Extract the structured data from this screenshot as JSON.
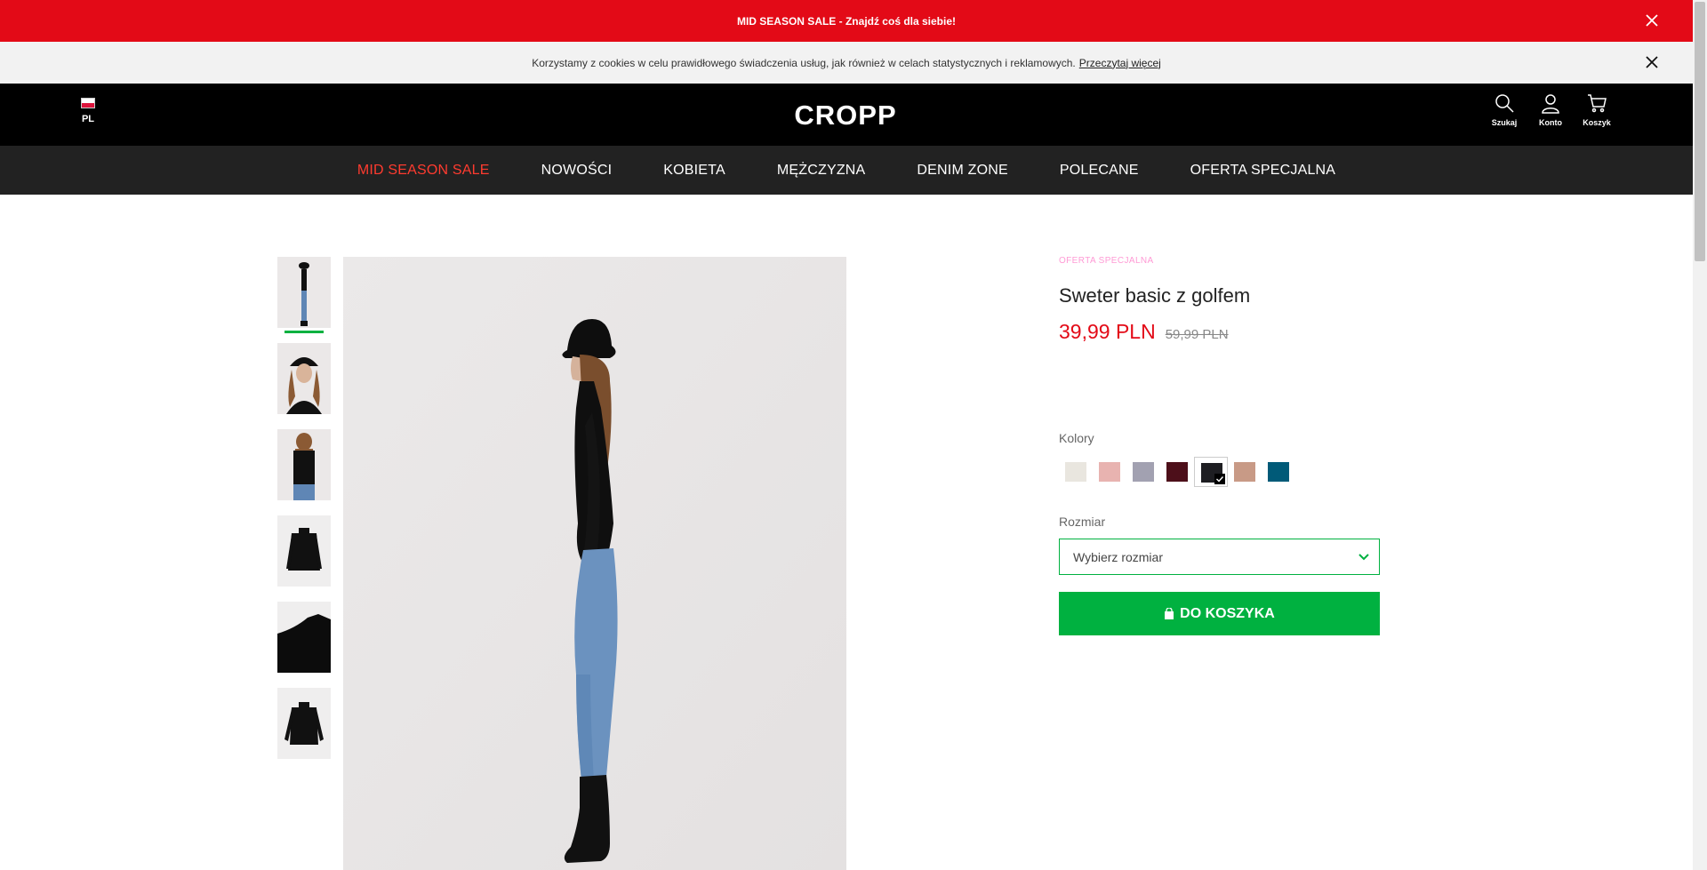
{
  "sale_bar": {
    "text": "MID SEASON SALE - Znajdź coś dla siebie!"
  },
  "cookie_bar": {
    "text": "Korzystamy z cookies w celu prawidłowego świadczenia usług, jak również w celach statystycznych i reklamowych.",
    "link": "Przeczytaj więcej"
  },
  "header": {
    "language": "PL",
    "logo": "CROPP",
    "icons": [
      {
        "label": "Szukaj",
        "icon": "search-icon"
      },
      {
        "label": "Konto",
        "icon": "user-icon"
      },
      {
        "label": "Koszyk",
        "icon": "cart-icon"
      }
    ]
  },
  "nav": {
    "items": [
      {
        "label": "MID SEASON SALE"
      },
      {
        "label": "NOWOŚCI"
      },
      {
        "label": "KOBIETA"
      },
      {
        "label": "MĘŻCZYZNA"
      },
      {
        "label": "DENIM ZONE"
      },
      {
        "label": "POLECANE"
      },
      {
        "label": "OFERTA SPECJALNA"
      }
    ],
    "sale_color": "#ff3b2f"
  },
  "product": {
    "badge": "OFERTA SPECJALNA",
    "title": "Sweter basic z golfem",
    "price": "39,99 PLN",
    "old_price": "59,99 PLN",
    "colors_label": "Kolory",
    "colors": [
      "#e9e6df",
      "#e8b3b0",
      "#a2a1b1",
      "#4d0f1a",
      "#1e1e22",
      "#c89a86",
      "#005a78"
    ],
    "selected_color_index": 4,
    "size_label": "Rozmiar",
    "size_placeholder": "Wybierz rozmiar",
    "add_to_cart": "DO KOSZYKA"
  },
  "gallery": {
    "thumb_count": 6,
    "active_thumb": 0
  },
  "colors": {
    "accent_green": "#00b140",
    "sale_red": "#e30a17",
    "badge_pink": "#ff9ad5"
  }
}
